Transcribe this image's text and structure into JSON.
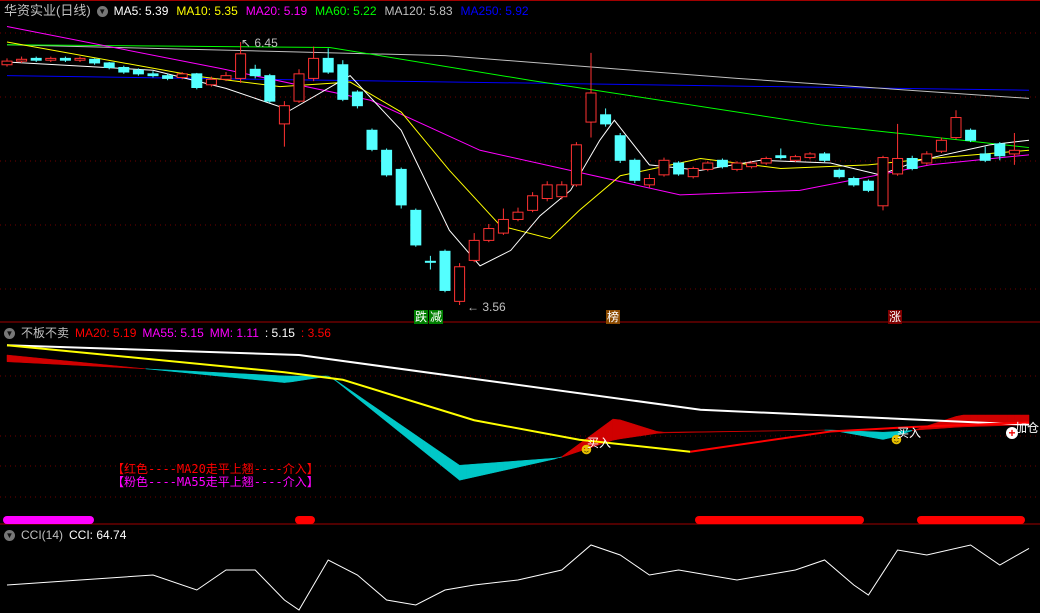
{
  "main_panel": {
    "title": "华资实业(日线)",
    "indicators": [
      {
        "label": "MA5: 5.39",
        "color": "#ffffff"
      },
      {
        "label": "MA10: 5.35",
        "color": "#ffff00"
      },
      {
        "label": "MA20: 5.19",
        "color": "#ff00ff"
      },
      {
        "label": "MA60: 5.22",
        "color": "#00ff00"
      },
      {
        "label": "MA120: 5.83",
        "color": "#c0c0c0"
      },
      {
        "label": "MA250: 5.92",
        "color": "#0000ff"
      }
    ],
    "high_label": "6.45",
    "low_label": "3.56",
    "tags": [
      {
        "text": "跌",
        "color": "#008000"
      },
      {
        "text": "减",
        "color": "#008000"
      },
      {
        "text": "榜",
        "color": "#8b4a00"
      },
      {
        "text": "涨",
        "color": "#800000"
      }
    ]
  },
  "sub_panel": {
    "title": "不板不卖",
    "indicators": [
      {
        "label": "MA20: 5.19",
        "color": "#ff0000"
      },
      {
        "label": "MA55: 5.15",
        "color": "#ff00ff"
      },
      {
        "label": "MM: 1.11",
        "color": "#ff00ff"
      },
      {
        "label": ": 5.15",
        "color": "#ffffff"
      },
      {
        "label": ": 3.56",
        "color": "#ff0000"
      }
    ],
    "notes": [
      {
        "text": "【红色----MA20走平上翘----介入】",
        "color": "#ff0000"
      },
      {
        "text": "【粉色----MA55走平上翘----介入】",
        "color": "#ff00ff"
      }
    ],
    "signals": [
      {
        "text": "买入",
        "icon": "smiley-icon"
      },
      {
        "text": "买入",
        "icon": "smiley-icon"
      },
      {
        "text": "加仓",
        "icon": "plus-circle-icon"
      }
    ]
  },
  "cci_panel": {
    "title": "CCI(14)",
    "value_label": "CCI: 64.74"
  },
  "chart_data": [
    {
      "type": "candlestick",
      "title": "华资实业(日线)",
      "ylim": [
        3.3,
        6.9
      ],
      "candles_ochl": [
        [
          6.2,
          6.24,
          6.27,
          6.18
        ],
        [
          6.24,
          6.26,
          6.29,
          6.22
        ],
        [
          6.27,
          6.25,
          6.29,
          6.23
        ],
        [
          6.25,
          6.27,
          6.29,
          6.23
        ],
        [
          6.27,
          6.25,
          6.29,
          6.23
        ],
        [
          6.25,
          6.27,
          6.29,
          6.23
        ],
        [
          6.26,
          6.22,
          6.27,
          6.2
        ],
        [
          6.22,
          6.17,
          6.23,
          6.15
        ],
        [
          6.17,
          6.12,
          6.19,
          6.1
        ],
        [
          6.14,
          6.1,
          6.16,
          6.08
        ],
        [
          6.1,
          6.08,
          6.13,
          6.06
        ],
        [
          6.08,
          6.05,
          6.1,
          6.03
        ],
        [
          6.06,
          6.1,
          6.12,
          6.04
        ],
        [
          6.1,
          5.95,
          6.11,
          5.93
        ],
        [
          5.98,
          6.04,
          6.07,
          5.96
        ],
        [
          6.04,
          6.08,
          6.12,
          6.02
        ],
        [
          6.05,
          6.32,
          6.45,
          6.0
        ],
        [
          6.15,
          6.08,
          6.2,
          6.05
        ],
        [
          6.08,
          5.8,
          6.1,
          5.78
        ],
        [
          5.55,
          5.75,
          5.8,
          5.3
        ],
        [
          5.8,
          6.1,
          6.15,
          5.78
        ],
        [
          6.05,
          6.27,
          6.4,
          6.02
        ],
        [
          6.27,
          6.12,
          6.38,
          6.1
        ],
        [
          6.2,
          5.82,
          6.25,
          5.8
        ],
        [
          5.9,
          5.75,
          5.92,
          5.72
        ],
        [
          5.48,
          5.27,
          5.5,
          5.25
        ],
        [
          5.26,
          4.99,
          5.28,
          4.97
        ],
        [
          5.05,
          4.66,
          5.07,
          4.62
        ],
        [
          4.6,
          4.22,
          4.62,
          4.2
        ],
        [
          4.04,
          4.03,
          4.1,
          3.95
        ],
        [
          4.15,
          3.72,
          4.17,
          3.7
        ],
        [
          3.6,
          3.98,
          4.02,
          3.56
        ],
        [
          4.05,
          4.27,
          4.35,
          4.03
        ],
        [
          4.27,
          4.4,
          4.45,
          4.25
        ],
        [
          4.35,
          4.5,
          4.62,
          4.33
        ],
        [
          4.5,
          4.58,
          4.63,
          4.48
        ],
        [
          4.6,
          4.76,
          4.8,
          4.58
        ],
        [
          4.73,
          4.88,
          4.92,
          4.7
        ],
        [
          4.75,
          4.88,
          4.92,
          4.72
        ],
        [
          4.88,
          5.32,
          5.35,
          4.86
        ],
        [
          5.57,
          5.89,
          6.33,
          5.4
        ],
        [
          5.65,
          5.55,
          5.72,
          5.52
        ],
        [
          5.42,
          5.15,
          5.45,
          5.12
        ],
        [
          5.15,
          4.93,
          5.17,
          4.9
        ],
        [
          4.88,
          4.95,
          5.0,
          4.85
        ],
        [
          4.99,
          5.15,
          5.18,
          4.97
        ],
        [
          5.12,
          5.0,
          5.14,
          4.98
        ],
        [
          4.97,
          5.06,
          5.08,
          4.95
        ],
        [
          5.05,
          5.12,
          5.14,
          5.03
        ],
        [
          5.15,
          5.08,
          5.17,
          5.06
        ],
        [
          5.05,
          5.12,
          5.14,
          5.03
        ],
        [
          5.08,
          5.12,
          5.14,
          5.06
        ],
        [
          5.12,
          5.17,
          5.19,
          5.1
        ],
        [
          5.2,
          5.18,
          5.28,
          5.16
        ],
        [
          5.15,
          5.19,
          5.21,
          5.13
        ],
        [
          5.18,
          5.22,
          5.24,
          5.16
        ],
        [
          5.22,
          5.15,
          5.24,
          5.13
        ],
        [
          5.04,
          4.97,
          5.06,
          4.95
        ],
        [
          4.95,
          4.88,
          4.97,
          4.86
        ],
        [
          4.92,
          4.82,
          4.94,
          4.8
        ],
        [
          4.65,
          5.18,
          5.2,
          4.6
        ],
        [
          5.0,
          5.17,
          5.55,
          4.98
        ],
        [
          5.17,
          5.06,
          5.2,
          5.04
        ],
        [
          5.12,
          5.22,
          5.25,
          5.1
        ],
        [
          5.25,
          5.37,
          5.4,
          5.23
        ],
        [
          5.4,
          5.62,
          5.7,
          5.38
        ],
        [
          5.48,
          5.37,
          5.5,
          5.35
        ],
        [
          5.22,
          5.15,
          5.3,
          5.13
        ],
        [
          5.33,
          5.2,
          5.35,
          5.15
        ],
        [
          5.22,
          5.26,
          5.45,
          5.1
        ]
      ],
      "ma_series": [
        {
          "name": "MA5",
          "color": "#ffffff",
          "points": [
            [
              0,
              6.23
            ],
            [
              10,
              6.14
            ],
            [
              15,
              5.94
            ],
            [
              19.4,
              5.7
            ],
            [
              23.5,
              6.08
            ],
            [
              27,
              5.48
            ],
            [
              30.3,
              4.38
            ],
            [
              32.4,
              3.99
            ],
            [
              34.5,
              4.16
            ],
            [
              36.5,
              4.54
            ],
            [
              38.6,
              4.82
            ],
            [
              40.6,
              5.37
            ],
            [
              41.6,
              5.59
            ],
            [
              44,
              5.1
            ],
            [
              47.5,
              5.04
            ],
            [
              51.6,
              5.15
            ],
            [
              56.4,
              5.12
            ],
            [
              59.8,
              4.99
            ],
            [
              62.5,
              5.15
            ],
            [
              67.3,
              5.32
            ],
            [
              70,
              5.37
            ]
          ]
        },
        {
          "name": "MA10",
          "color": "#ffff00",
          "points": [
            [
              0,
              6.45
            ],
            [
              13.2,
              6.07
            ],
            [
              18.7,
              5.96
            ],
            [
              23.5,
              6.01
            ],
            [
              27,
              5.68
            ],
            [
              30.3,
              5.04
            ],
            [
              33.8,
              4.43
            ],
            [
              37.2,
              4.29
            ],
            [
              39.2,
              4.6
            ],
            [
              42,
              4.98
            ],
            [
              47.5,
              5.17
            ],
            [
              53,
              5.06
            ],
            [
              59,
              5.1
            ],
            [
              63.2,
              5.17
            ],
            [
              70,
              5.26
            ]
          ]
        },
        {
          "name": "MA20",
          "color": "#ff00ff",
          "points": [
            [
              0,
              6.62
            ],
            [
              14.6,
              6.16
            ],
            [
              24.9,
              5.81
            ],
            [
              32.4,
              5.26
            ],
            [
              46.1,
              4.77
            ],
            [
              54.3,
              4.82
            ],
            [
              63.2,
              5.1
            ],
            [
              70,
              5.21
            ]
          ]
        },
        {
          "name": "MA60",
          "color": "#00ff00",
          "points": [
            [
              0,
              6.42
            ],
            [
              22.1,
              6.39
            ],
            [
              35.8,
              6.03
            ],
            [
              55.7,
              5.54
            ],
            [
              70,
              5.29
            ]
          ]
        },
        {
          "name": "MA120",
          "color": "#c0c0c0",
          "points": [
            [
              0,
              6.42
            ],
            [
              30,
              6.3
            ],
            [
              50,
              6.05
            ],
            [
              70,
              5.83
            ]
          ]
        },
        {
          "name": "MA250",
          "color": "#0000ff",
          "points": [
            [
              0,
              6.08
            ],
            [
              70,
              5.92
            ]
          ]
        }
      ]
    },
    {
      "type": "line",
      "title": "不板不卖",
      "ylim": [
        3.9,
        6.5
      ],
      "white": [
        [
          0,
          6.23
        ],
        [
          20,
          6.1
        ],
        [
          47.5,
          5.37
        ],
        [
          70,
          5.17
        ]
      ],
      "yellow": [
        [
          0,
          6.23
        ],
        [
          19,
          5.87
        ],
        [
          23,
          5.77
        ],
        [
          32,
          5.23
        ],
        [
          39.2,
          4.97
        ],
        [
          46.8,
          4.81
        ]
      ],
      "red_line": [
        [
          46.8,
          4.81
        ],
        [
          56.4,
          5.08
        ],
        [
          62,
          5.14
        ],
        [
          70,
          5.2
        ]
      ],
      "band_fast": [
        [
          0,
          6.1
        ],
        [
          19.1,
          5.73
        ],
        [
          22.1,
          5.82
        ],
        [
          31,
          4.43
        ],
        [
          37.9,
          4.73
        ],
        [
          41.6,
          5.26
        ],
        [
          44.7,
          5.07
        ],
        [
          56.4,
          5.1
        ],
        [
          60.1,
          4.97
        ],
        [
          65.3,
          5.3
        ],
        [
          70,
          5.3
        ]
      ],
      "band_slow": [
        [
          0,
          6.01
        ],
        [
          19.1,
          5.82
        ],
        [
          22.1,
          5.82
        ],
        [
          31,
          4.63
        ],
        [
          37.9,
          4.73
        ],
        [
          41.6,
          4.97
        ],
        [
          44.7,
          5.06
        ],
        [
          56.4,
          5.1
        ],
        [
          60.1,
          5.07
        ],
        [
          65.3,
          5.14
        ],
        [
          70,
          5.17
        ]
      ],
      "signal_bars": [
        {
          "from": 0,
          "to": 6.2,
          "color": "#ff00ff"
        },
        {
          "from": 20,
          "to": 21.4,
          "color": "#ff0000"
        },
        {
          "from": 47.4,
          "to": 59,
          "color": "#ff0000"
        },
        {
          "from": 62.6,
          "to": 70,
          "color": "#ff0000"
        }
      ]
    },
    {
      "type": "line",
      "title": "CCI(14)",
      "ylim": [
        -150,
        150
      ],
      "points": [
        [
          0,
          -45
        ],
        [
          5,
          -30
        ],
        [
          10,
          -15
        ],
        [
          13,
          -60
        ],
        [
          15,
          0
        ],
        [
          17,
          0
        ],
        [
          19,
          -90
        ],
        [
          20,
          -120
        ],
        [
          22,
          30
        ],
        [
          24,
          -15
        ],
        [
          26,
          -90
        ],
        [
          28,
          -105
        ],
        [
          30,
          -60
        ],
        [
          32,
          -45
        ],
        [
          35,
          -30
        ],
        [
          38,
          0
        ],
        [
          40,
          75
        ],
        [
          42,
          45
        ],
        [
          44,
          -15
        ],
        [
          46,
          0
        ],
        [
          48,
          -15
        ],
        [
          50,
          -30
        ],
        [
          52,
          -15
        ],
        [
          54,
          0
        ],
        [
          56,
          30
        ],
        [
          58,
          -45
        ],
        [
          59,
          -75
        ],
        [
          61,
          60
        ],
        [
          63,
          45
        ],
        [
          66,
          75
        ],
        [
          68,
          15
        ],
        [
          70,
          64.74
        ]
      ]
    }
  ]
}
